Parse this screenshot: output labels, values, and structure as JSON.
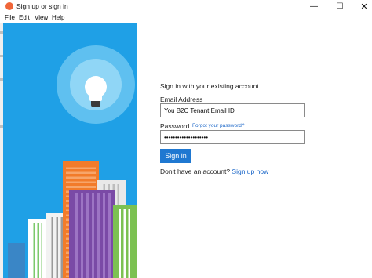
{
  "window": {
    "title": "Sign up or sign in",
    "controls": {
      "minimize": "—",
      "maximize": "☐",
      "close": "✕"
    }
  },
  "menu": [
    "File",
    "Edit",
    "View",
    "Help"
  ],
  "form": {
    "heading": "Sign in with your existing account",
    "email_label": "Email Address",
    "email_value": "You B2C Tenant Email ID",
    "password_label": "Password",
    "forgot_link": "Forgot your password?",
    "password_value": "••••••••••••••••••••",
    "signin_label": "Sign in",
    "no_account_text": "Don't have an account?",
    "signup_link": "Sign up now"
  },
  "colors": {
    "accent": "#1f78d1",
    "hero_background": "#1fa0e6",
    "app_icon": "#f0663a"
  },
  "icons": {
    "app": "app-logo-icon",
    "illustration": "lightbulb-icon"
  }
}
